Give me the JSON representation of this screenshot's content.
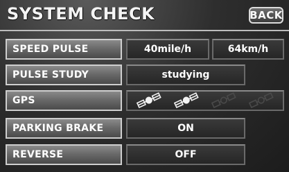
{
  "header": {
    "title": "SYSTEM CHECK",
    "back_label": "BACK"
  },
  "rows": [
    {
      "label": "SPEED PULSE",
      "values": [
        "40mile/h",
        "64km/h"
      ]
    },
    {
      "label": "PULSE STUDY",
      "value": "studying"
    },
    {
      "label": "GPS",
      "satellites": [
        {
          "state": "active"
        },
        {
          "state": "active"
        },
        {
          "state": "dim"
        },
        {
          "state": "dim"
        }
      ]
    },
    {
      "label": "PARKING BRAKE",
      "value": "ON"
    },
    {
      "label": "REVERSE",
      "value": "OFF"
    }
  ],
  "icons": {
    "satellite": "satellite-icon"
  },
  "colors": {
    "text": "#ffffff",
    "border": "#cfcfcf",
    "panel": "#2a2a2a"
  }
}
